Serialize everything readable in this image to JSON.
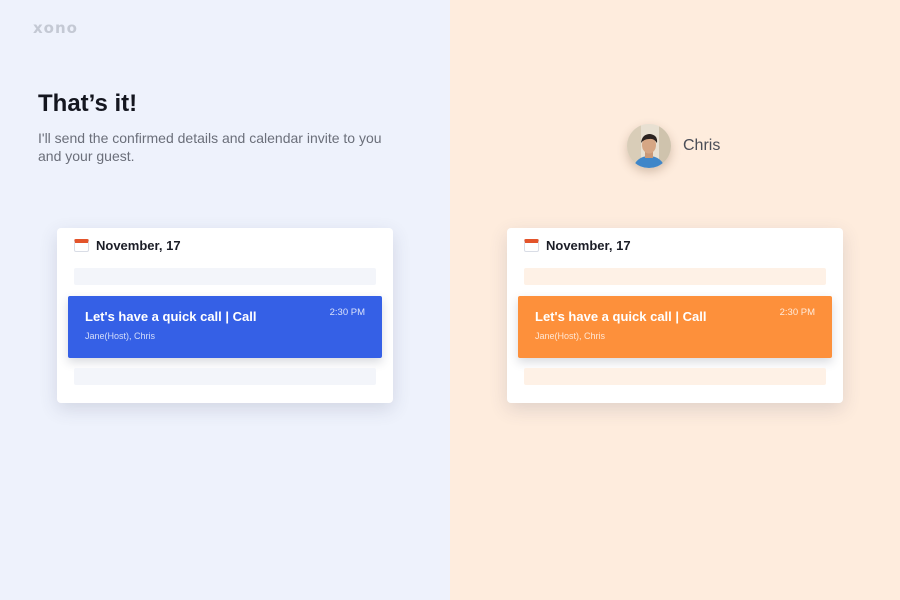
{
  "brand": {
    "logo": "xono"
  },
  "intro": {
    "headline": "That’s it!",
    "message": "I'll send the confirmed details and calendar invite to you and your guest."
  },
  "host_card": {
    "date": "November, 17",
    "event": {
      "title": "Let's have a quick call | Call",
      "guests": "Jane(Host), Chris",
      "time": "2:30 PM"
    },
    "accent": "#3560e6"
  },
  "guest_panel": {
    "name": "Chris",
    "card": {
      "date": "November, 17",
      "event": {
        "title": "Let's have a quick call | Call",
        "guests": "Jane(Host), Chris",
        "time": "2:30 PM"
      },
      "accent": "#fd903b"
    }
  }
}
